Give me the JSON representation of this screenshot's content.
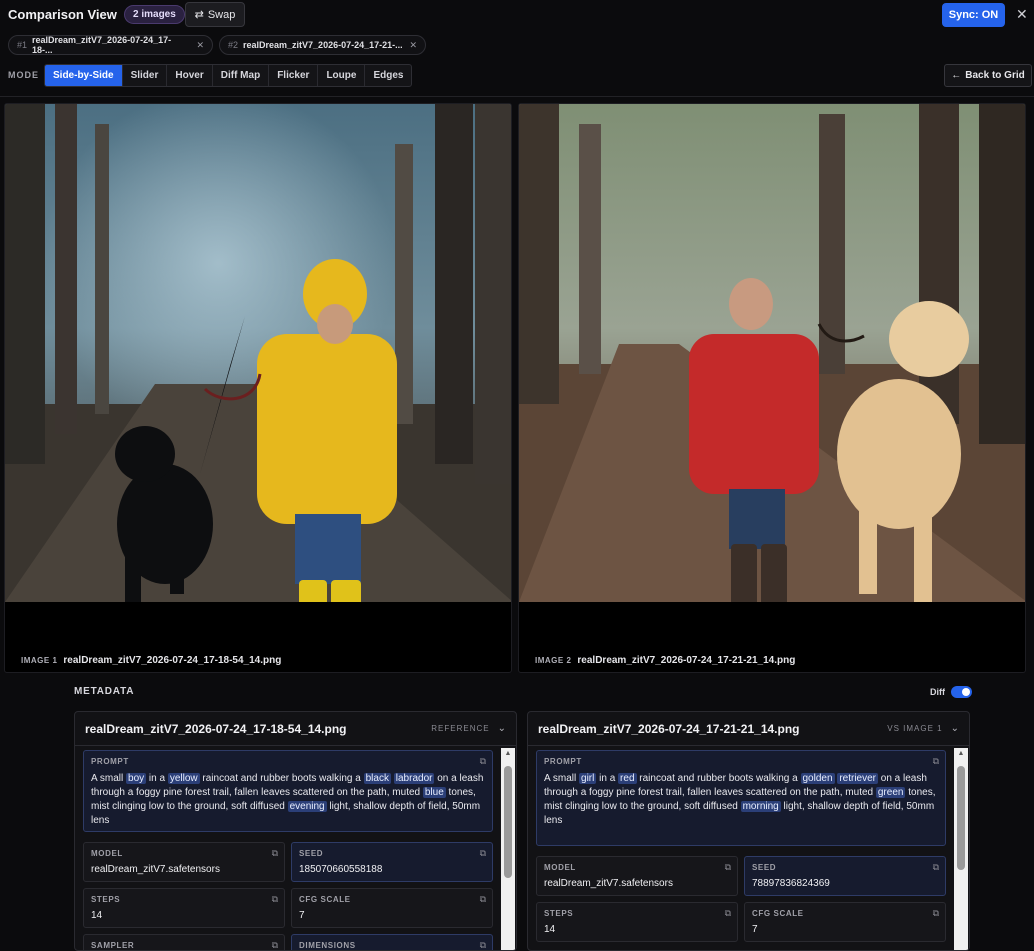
{
  "header": {
    "title": "Comparison View",
    "badge": "2 images",
    "swap_label": "Swap",
    "sync_label": "Sync: ON"
  },
  "file_tabs": [
    {
      "num": "#1",
      "name": "realDream_zitV7_2026-07-24_17-18-..."
    },
    {
      "num": "#2",
      "name": "realDream_zitV7_2026-07-24_17-21-..."
    }
  ],
  "modebar": {
    "label": "MODE",
    "modes": [
      "Side-by-Side",
      "Slider",
      "Hover",
      "Diff Map",
      "Flicker",
      "Loupe",
      "Edges"
    ],
    "active": "Side-by-Side",
    "back_label": "Back to Grid"
  },
  "images": [
    {
      "label": "IMAGE 1",
      "filename": "realDream_zitV7_2026-07-24_17-18-54_14.png"
    },
    {
      "label": "IMAGE 2",
      "filename": "realDream_zitV7_2026-07-24_17-21-21_14.png"
    }
  ],
  "metadata": {
    "header": "METADATA",
    "diff_label": "Diff",
    "diff_on": true,
    "columns": [
      {
        "filename": "realDream_zitV7_2026-07-24_17-18-54_14.png",
        "tag": "REFERENCE",
        "prompt_label": "PROMPT",
        "prompt_parts": [
          {
            "t": "A small "
          },
          {
            "t": "boy",
            "h": true
          },
          {
            "t": " in a "
          },
          {
            "t": "yellow",
            "h": true
          },
          {
            "t": " raincoat and rubber boots walking a "
          },
          {
            "t": "black",
            "h": true
          },
          {
            "t": " "
          },
          {
            "t": "labrador",
            "h": true
          },
          {
            "t": " on a leash through a foggy pine forest trail, fallen leaves scattered on the path, muted "
          },
          {
            "t": "blue",
            "h": true
          },
          {
            "t": " tones, mist clinging low to the ground, soft diffused "
          },
          {
            "t": "evening",
            "h": true
          },
          {
            "t": " light, shallow depth of field, 50mm lens"
          }
        ],
        "model_label": "MODEL",
        "model": "realDream_zitV7.safetensors",
        "seed_label": "SEED",
        "seed": "185070660558188",
        "steps_label": "STEPS",
        "steps": "14",
        "cfg_label": "CFG SCALE",
        "cfg": "7",
        "sampler_label": "SAMPLER",
        "dimensions_label": "DIMENSIONS"
      },
      {
        "filename": "realDream_zitV7_2026-07-24_17-21-21_14.png",
        "tag": "VS IMAGE 1",
        "prompt_label": "PROMPT",
        "prompt_parts": [
          {
            "t": "A small "
          },
          {
            "t": "girl",
            "h": true
          },
          {
            "t": " in a "
          },
          {
            "t": "red",
            "h": true
          },
          {
            "t": " raincoat and rubber boots walking a "
          },
          {
            "t": "golden",
            "h": true
          },
          {
            "t": " "
          },
          {
            "t": "retriever",
            "h": true
          },
          {
            "t": " on a leash through a foggy pine forest trail, fallen leaves scattered on the path, muted "
          },
          {
            "t": "green",
            "h": true
          },
          {
            "t": " tones, mist clinging low to the ground, soft diffused "
          },
          {
            "t": "morning",
            "h": true
          },
          {
            "t": " light, shallow depth of field, 50mm lens"
          }
        ],
        "model_label": "MODEL",
        "model": "realDream_zitV7.safetensors",
        "seed_label": "SEED",
        "seed": "78897836824369",
        "steps_label": "STEPS",
        "steps": "14",
        "cfg_label": "CFG SCALE",
        "cfg": "7"
      }
    ]
  },
  "icons": {
    "swap": "swap-arrows-icon",
    "close": "close-icon",
    "back": "arrow-left-icon",
    "copy": "copy-icon",
    "chevron": "chevron-down-icon"
  }
}
